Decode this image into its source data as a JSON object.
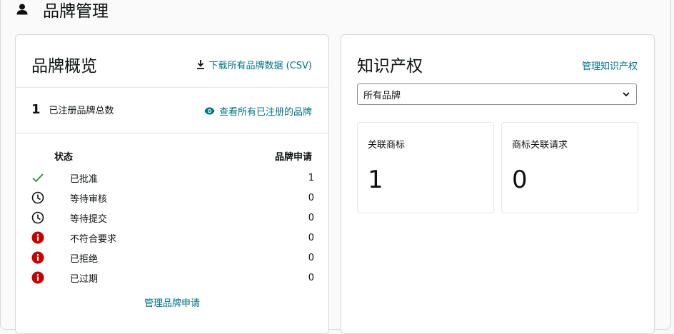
{
  "page": {
    "title": "品牌管理",
    "icon": "user-icon"
  },
  "overview": {
    "title": "品牌概览",
    "download_link": "下载所有品牌数据 (CSV)",
    "total_count": "1",
    "total_label": "已注册品牌总数",
    "view_registered_link": "查看所有已注册的品牌",
    "status_header": "状态",
    "applications_header": "品牌申请",
    "statuses": [
      {
        "label": "已批准",
        "count": "1",
        "icon": "check-icon"
      },
      {
        "label": "等待审核",
        "count": "0",
        "icon": "clock-icon"
      },
      {
        "label": "等待提交",
        "count": "0",
        "icon": "clock-icon"
      },
      {
        "label": "不符合要求",
        "count": "0",
        "icon": "alert-icon"
      },
      {
        "label": "已拒绝",
        "count": "0",
        "icon": "alert-icon"
      },
      {
        "label": "已过期",
        "count": "0",
        "icon": "alert-icon"
      }
    ],
    "manage_applications_link": "管理品牌申请"
  },
  "ip": {
    "title": "知识产权",
    "manage_link": "管理知识产权",
    "brand_filter": {
      "selected": "所有品牌"
    },
    "stats": [
      {
        "label": "关联商标",
        "value": "1"
      },
      {
        "label": "商标关联请求",
        "value": "0"
      }
    ]
  },
  "colors": {
    "link": "#007185",
    "success": "#2f8a44",
    "error": "#c40000",
    "text": "#0f1111"
  }
}
